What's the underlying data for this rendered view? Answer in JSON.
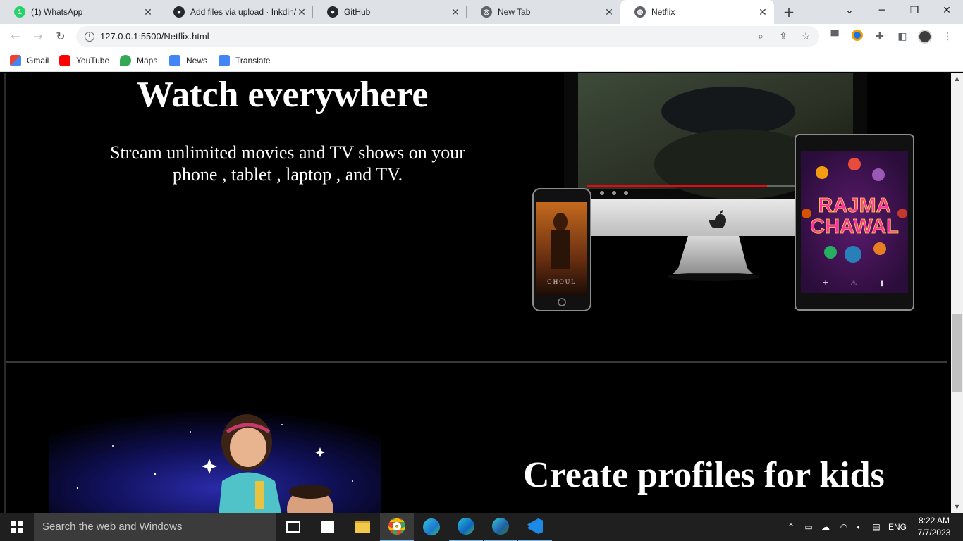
{
  "browser": {
    "tabs": [
      {
        "title": "(1) WhatsApp",
        "icon": "whatsapp-icon",
        "badge": "1"
      },
      {
        "title": "Add files via upload · Inkdin/",
        "icon": "github-icon"
      },
      {
        "title": "GitHub",
        "icon": "github-icon"
      },
      {
        "title": "New Tab",
        "icon": "chrome-icon"
      },
      {
        "title": "Netflix",
        "icon": "globe-icon",
        "active": true
      }
    ],
    "address": "127.0.0.1:5500/Netflix.html",
    "bookmarks": [
      {
        "label": "Gmail",
        "icon": "gmail-icon",
        "color": "#ea4335"
      },
      {
        "label": "YouTube",
        "icon": "youtube-icon",
        "color": "#ff0000"
      },
      {
        "label": "Maps",
        "icon": "maps-icon",
        "color": "#34a853"
      },
      {
        "label": "News",
        "icon": "news-icon",
        "color": "#4285f4"
      },
      {
        "label": "Translate",
        "icon": "translate-icon",
        "color": "#4285f4"
      }
    ]
  },
  "page": {
    "section1": {
      "heading": "Watch everywhere",
      "text_line1": "Stream unlimited movies and TV shows on your",
      "text_line2": "phone , tablet , laptop , and TV.",
      "phone_poster_title": "GHOUL",
      "tablet_poster_line1": "RAJMA",
      "tablet_poster_line2": "CHAWAL"
    },
    "section2": {
      "heading": "Create profiles for kids"
    }
  },
  "taskbar": {
    "search_placeholder": "Search the web and Windows",
    "apps": [
      "task-view-icon",
      "store-icon",
      "file-explorer-icon",
      "chrome-icon",
      "edge-icon",
      "edge-beta-icon",
      "edge-dev-icon",
      "vscode-icon"
    ],
    "language": "ENG",
    "time": "8:22 AM",
    "date": "7/7/2023"
  },
  "colors": {
    "accent": "#e50914",
    "page_bg": "#000000",
    "taskbar": "#1f1f1f"
  }
}
